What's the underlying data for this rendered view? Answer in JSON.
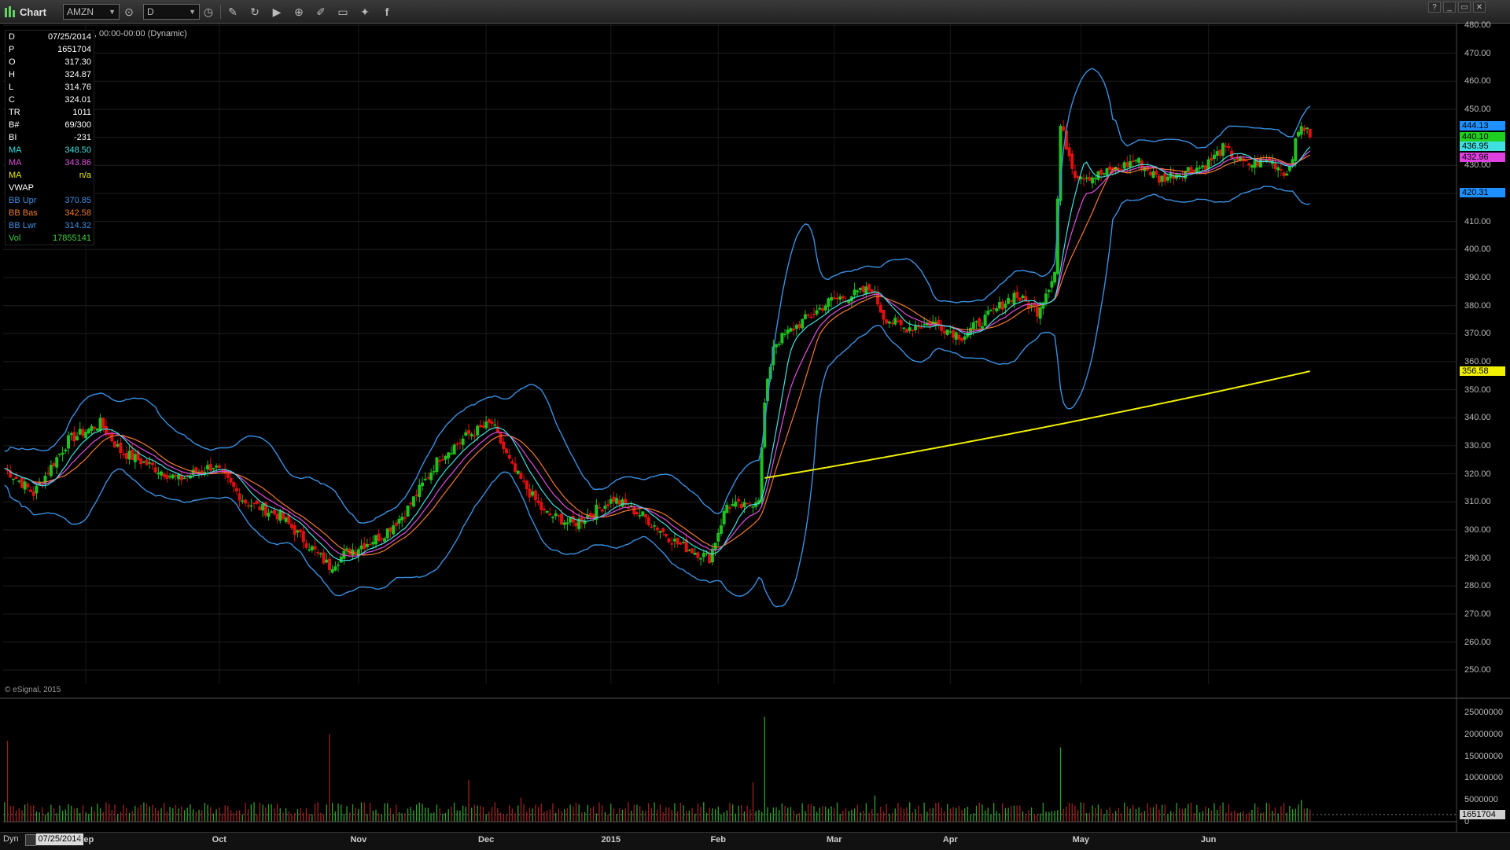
{
  "toolbar": {
    "title": "Chart",
    "symbol": "AMZN",
    "interval": "D",
    "icons": [
      "clock-icon",
      "pencil-icon",
      "refresh-icon",
      "play-icon",
      "zoom-icon",
      "draw-icon",
      "comment-icon",
      "twitter-icon",
      "facebook-icon"
    ],
    "window_buttons": [
      "?",
      "_",
      "▭",
      "✕"
    ]
  },
  "chart_title": "AMAZON.COM INC, D, 00:00-00:00 (Dynamic)",
  "info_panel": [
    {
      "label": "D",
      "value": "07/25/2014",
      "color": "#ffffff"
    },
    {
      "label": "P",
      "value": "1651704",
      "color": "#ffffff"
    },
    {
      "label": "O",
      "value": "317.30",
      "color": "#ffffff"
    },
    {
      "label": "H",
      "value": "324.87",
      "color": "#ffffff"
    },
    {
      "label": "L",
      "value": "314.76",
      "color": "#ffffff"
    },
    {
      "label": "C",
      "value": "324.01",
      "color": "#ffffff"
    },
    {
      "label": "TR",
      "value": "1011",
      "color": "#ffffff"
    },
    {
      "label": "B#",
      "value": "69/300",
      "color": "#ffffff"
    },
    {
      "label": "BI",
      "value": "-231",
      "color": "#ffffff"
    },
    {
      "label": "MA",
      "value": "348.50",
      "color": "#3fe0e0"
    },
    {
      "label": "MA",
      "value": "343.86",
      "color": "#e050e0"
    },
    {
      "label": "MA",
      "value": "n/a",
      "color": "#f0f000"
    },
    {
      "label": "VWAP",
      "value": "",
      "color": "#ffffff"
    },
    {
      "label": "BB Upr",
      "value": "370.85",
      "color": "#3a8fe0"
    },
    {
      "label": "BB Bas",
      "value": "342.58",
      "color": "#f07830"
    },
    {
      "label": "BB Lwr",
      "value": "314.32",
      "color": "#3a8fe0"
    },
    {
      "label": "Vol",
      "value": "17855141",
      "color": "#40d040"
    }
  ],
  "watermark": "© eSignal, 2015",
  "bottom": {
    "dyn": "Dyn",
    "date": "07/25/2014"
  },
  "colors": {
    "up": "#20c020",
    "down": "#e01010",
    "bb": "#3a8fe0",
    "bb_basis": "#f07830",
    "ma_fast": "#3fe0e0",
    "ma_mid": "#e050e0",
    "ma_slow": "#f0f000",
    "volume_up": "#30a030",
    "volume_down": "#a02020",
    "grid": "#1e1e1e"
  },
  "chart_data": [
    {
      "type": "candlestick",
      "symbol": "AMZN",
      "ylim": [
        245,
        480
      ],
      "ticks": [
        250,
        260,
        270,
        280,
        290,
        300,
        310,
        320,
        330,
        340,
        350,
        360,
        370,
        380,
        390,
        400,
        410,
        420,
        430,
        440,
        450,
        460,
        470,
        480
      ],
      "x_labels": [
        "Sep",
        "Oct",
        "Nov",
        "Dec",
        "2015",
        "Feb",
        "Mar",
        "Apr",
        "May",
        "Jun"
      ],
      "x_label_bars": [
        28,
        74,
        122,
        166,
        209,
        246,
        286,
        326,
        371,
        415
      ],
      "bar_count": 501,
      "price_anchors": [
        {
          "bar": 0,
          "close": 322
        },
        {
          "bar": 10,
          "close": 313
        },
        {
          "bar": 22,
          "close": 332
        },
        {
          "bar": 33,
          "close": 338
        },
        {
          "bar": 40,
          "close": 328
        },
        {
          "bar": 50,
          "close": 323
        },
        {
          "bar": 60,
          "close": 318
        },
        {
          "bar": 72,
          "close": 323
        },
        {
          "bar": 83,
          "close": 310
        },
        {
          "bar": 95,
          "close": 305
        },
        {
          "bar": 112,
          "close": 287
        },
        {
          "bar": 118,
          "close": 292
        },
        {
          "bar": 130,
          "close": 298
        },
        {
          "bar": 138,
          "close": 306
        },
        {
          "bar": 150,
          "close": 326
        },
        {
          "bar": 160,
          "close": 334
        },
        {
          "bar": 168,
          "close": 338
        },
        {
          "bar": 175,
          "close": 322
        },
        {
          "bar": 186,
          "close": 306
        },
        {
          "bar": 196,
          "close": 302
        },
        {
          "bar": 210,
          "close": 311
        },
        {
          "bar": 220,
          "close": 305
        },
        {
          "bar": 232,
          "close": 295
        },
        {
          "bar": 243,
          "close": 290
        },
        {
          "bar": 249,
          "close": 309
        },
        {
          "bar": 256,
          "close": 308
        },
        {
          "bar": 260,
          "close": 312
        },
        {
          "bar": 262,
          "close": 345
        },
        {
          "bar": 265,
          "close": 366
        },
        {
          "bar": 272,
          "close": 372
        },
        {
          "bar": 285,
          "close": 382
        },
        {
          "bar": 293,
          "close": 384
        },
        {
          "bar": 299,
          "close": 386
        },
        {
          "bar": 303,
          "close": 376
        },
        {
          "bar": 310,
          "close": 372
        },
        {
          "bar": 320,
          "close": 374
        },
        {
          "bar": 330,
          "close": 369
        },
        {
          "bar": 340,
          "close": 377
        },
        {
          "bar": 348,
          "close": 384
        },
        {
          "bar": 356,
          "close": 378
        },
        {
          "bar": 362,
          "close": 392
        },
        {
          "bar": 364,
          "close": 444
        },
        {
          "bar": 369,
          "close": 427
        },
        {
          "bar": 375,
          "close": 426
        },
        {
          "bar": 382,
          "close": 428
        },
        {
          "bar": 390,
          "close": 432
        },
        {
          "bar": 398,
          "close": 425
        },
        {
          "bar": 406,
          "close": 428
        },
        {
          "bar": 414,
          "close": 430
        },
        {
          "bar": 420,
          "close": 436
        },
        {
          "bar": 428,
          "close": 430
        },
        {
          "bar": 436,
          "close": 432
        },
        {
          "bar": 442,
          "close": 427
        },
        {
          "bar": 447,
          "close": 445
        },
        {
          "bar": 450,
          "close": 440
        }
      ],
      "last_bar": 450,
      "moving_averages": [
        {
          "period": 10,
          "color": "#3fe0e0",
          "value": 348.5
        },
        {
          "period": 20,
          "color": "#e050e0",
          "value": 343.86
        },
        {
          "period": 200,
          "color": "#f0f000",
          "value": "n/a",
          "start_value": 318.5,
          "end_value": 356.58
        }
      ],
      "bollinger": {
        "upper": 370.85,
        "basis": 342.58,
        "lower": 314.32
      },
      "last_values": {
        "bb_upper": 444.13,
        "close": 440.1,
        "ma_fast": 436.95,
        "ma_mid": 432.96,
        "bb_lower": 420.31,
        "ma_slow": 356.58
      },
      "badges": [
        {
          "label": "444.13",
          "color": "#1e90ff"
        },
        {
          "label": "440.10",
          "color": "#20d020"
        },
        {
          "label": "436.95",
          "color": "#40e0e0"
        },
        {
          "label": "432.96",
          "color": "#e040e0"
        },
        {
          "label": "420.31",
          "color": "#1e90ff"
        },
        {
          "label": "356.58",
          "color": "#f0f000"
        }
      ]
    },
    {
      "type": "bar",
      "series": "Volume",
      "ylim": [
        0,
        27000000
      ],
      "ticks": [
        "0",
        "5000000",
        "10000000",
        "15000000",
        "20000000",
        "25000000"
      ],
      "tick_values": [
        0,
        5000000,
        10000000,
        15000000,
        20000000,
        25000000
      ],
      "last_value": 1651704,
      "last_label": "1651704",
      "spikes": [
        {
          "bar": 1,
          "value": 18500000
        },
        {
          "bar": 112,
          "value": 20000000
        },
        {
          "bar": 160,
          "value": 9500000
        },
        {
          "bar": 178,
          "value": 5500000
        },
        {
          "bar": 262,
          "value": 24000000
        },
        {
          "bar": 258,
          "value": 9000000
        },
        {
          "bar": 364,
          "value": 17000000
        },
        {
          "bar": 300,
          "value": 6000000
        },
        {
          "bar": 447,
          "value": 5000000
        }
      ],
      "typical_volume": 3200000
    }
  ]
}
